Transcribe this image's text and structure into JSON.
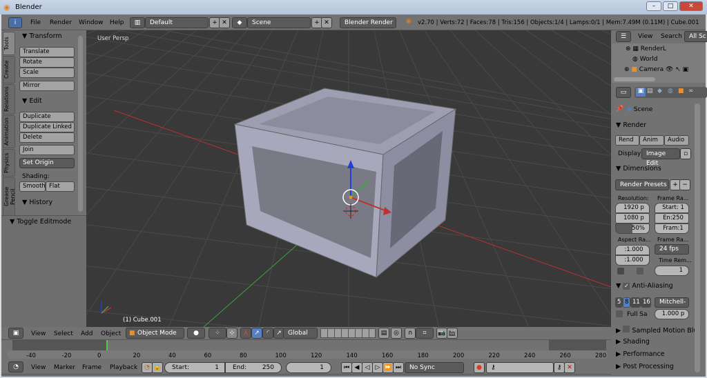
{
  "window": {
    "title": "Blender",
    "controls": [
      "–",
      "□",
      "✕"
    ]
  },
  "info_header": {
    "menus": [
      "File",
      "Render",
      "Window",
      "Help"
    ],
    "layout": "Default",
    "scene": "Scene",
    "engine": "Blender Render",
    "stats": "v2.70 | Verts:72 | Faces:78 | Tris:156 | Objects:1/4 | Lamps:0/1 | Mem:7.49M (0.11M) | Cube.001"
  },
  "tool_shelf": {
    "tabs": [
      "Tools",
      "Create",
      "Relations",
      "Animation",
      "Physics",
      "Grease Pencil"
    ],
    "transform": {
      "title": "Transform",
      "buttons": [
        "Translate",
        "Rotate",
        "Scale",
        "Mirror"
      ]
    },
    "edit": {
      "title": "Edit",
      "buttons": [
        "Duplicate",
        "Duplicate Linked",
        "Delete",
        "Join"
      ],
      "set_origin": "Set Origin",
      "shading_label": "Shading:",
      "smooth": "Smooth",
      "flat": "Flat"
    },
    "history": {
      "title": "History"
    },
    "operator": "Toggle Editmode"
  },
  "viewport": {
    "view_label": "User Persp",
    "object_label": "(1) Cube.001",
    "axis_colors": {
      "x": "#c03030",
      "y": "#40a040",
      "z": "#2040d0"
    }
  },
  "view3d_header": {
    "menus": [
      "View",
      "Select",
      "Add",
      "Object"
    ],
    "mode": "Object Mode",
    "orientation": "Global"
  },
  "timeline": {
    "ticks": [
      "-40",
      "-20",
      "0",
      "20",
      "40",
      "60",
      "80",
      "100",
      "120",
      "140",
      "160",
      "180",
      "200",
      "220",
      "240",
      "260",
      "280"
    ],
    "current_frame": 1
  },
  "timeline_header": {
    "menus": [
      "View",
      "Marker",
      "Frame",
      "Playback"
    ],
    "start_label": "Start:",
    "start": "1",
    "end_label": "End:",
    "end": "250",
    "current": "1",
    "sync": "No Sync"
  },
  "outliner": {
    "menus": [
      "View",
      "Search"
    ],
    "filter": "All Sc",
    "items": [
      "RenderL",
      "World",
      "Camera"
    ]
  },
  "properties": {
    "context": "Scene",
    "render": {
      "title": "Render",
      "buttons": [
        "Rend",
        "Anim",
        "Audio"
      ],
      "display_label": "Display",
      "display": "Image Edit"
    },
    "dimensions": {
      "title": "Dimensions",
      "presets": "Render Presets",
      "resolution_label": "Resolution:",
      "res_x": "1920 p",
      "res_y": "1080 p",
      "percent": "50%",
      "percent_value": 50,
      "frame_range_label": "Frame Ra...",
      "start": "Start: 1",
      "end": "En:250",
      "step": "Fram:1",
      "aspect_label": "Aspect Ra...",
      "aspect_x": ":1.000",
      "aspect_y": ":1.000",
      "frame_rate_label": "Frame Ra...",
      "fps": "24 fps",
      "time_remap_label": "Time Rem...",
      "time_remap": "1"
    },
    "anti_aliasing": {
      "title": "Anti-Aliasing",
      "samples": [
        "5",
        "8",
        "11",
        "16"
      ],
      "selected": "8",
      "filter": "Mitchell-",
      "full_sample": "Full Sa",
      "size": "1.000 p"
    },
    "collapsed": [
      "Sampled Motion Blur",
      "Shading",
      "Performance",
      "Post Processing"
    ]
  }
}
